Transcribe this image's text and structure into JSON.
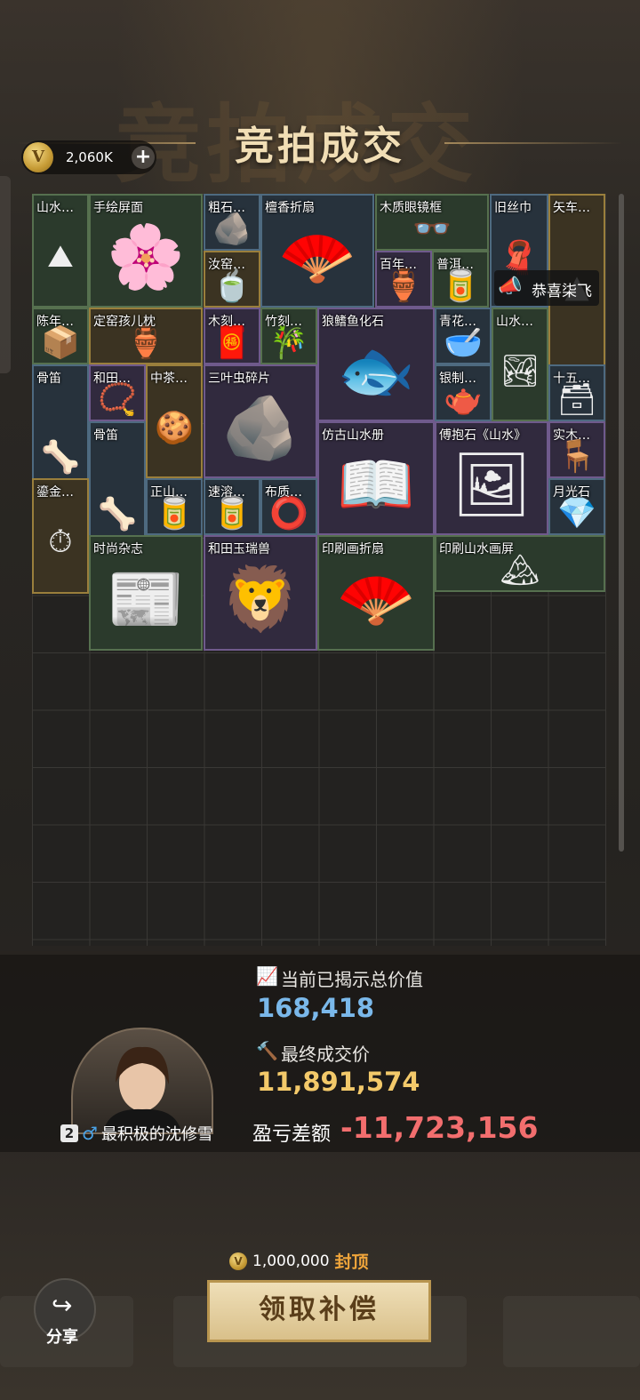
{
  "header": {
    "ghost_title": "竞拍成交",
    "title": "竞拍成交",
    "coins": "2,060K",
    "coin_symbol": "V",
    "add_symbol": "+"
  },
  "items": [
    {
      "label": "山水…",
      "art": "⛰",
      "color": "g"
    },
    {
      "label": "手绘屏面",
      "art": "🌸",
      "color": "g"
    },
    {
      "label": "粗石…",
      "art": "🪨",
      "color": "b"
    },
    {
      "label": "檀香折扇",
      "art": "🪭",
      "color": "b"
    },
    {
      "label": "木质眼镜框",
      "art": "👓",
      "color": "g"
    },
    {
      "label": "旧丝巾",
      "art": "🧣",
      "color": "b"
    },
    {
      "label": "矢车…",
      "art": "▲",
      "color": "y"
    },
    {
      "label": "汝窑…",
      "art": "🍵",
      "color": "y"
    },
    {
      "label": "百年…",
      "art": "🏺",
      "color": "p"
    },
    {
      "label": "普洱…",
      "art": "🥫",
      "color": "g"
    },
    {
      "label": "陈年…",
      "art": "📦",
      "color": "g"
    },
    {
      "label": "定窑孩儿枕",
      "art": "🏺",
      "color": "y"
    },
    {
      "label": "木刻…",
      "art": "🧧",
      "color": "p"
    },
    {
      "label": "竹刻…",
      "art": "🎋",
      "color": "g"
    },
    {
      "label": "狼鳍鱼化石",
      "art": "🐟",
      "color": "p"
    },
    {
      "label": "青花…",
      "art": "🥣",
      "color": "b"
    },
    {
      "label": "山水…",
      "art": "🏞",
      "color": "g"
    },
    {
      "label": "骨笛",
      "art": "🦴",
      "color": "b"
    },
    {
      "label": "和田…",
      "art": "📿",
      "color": "p"
    },
    {
      "label": "中茶…",
      "art": "🍪",
      "color": "y"
    },
    {
      "label": "三叶虫碎片",
      "art": "🪨",
      "color": "p"
    },
    {
      "label": "银制…",
      "art": "🫖",
      "color": "b"
    },
    {
      "label": "十五…",
      "art": "🗃",
      "color": "b"
    },
    {
      "label": "骨笛",
      "art": "🦴",
      "color": "b"
    },
    {
      "label": "仿古山水册",
      "art": "📖",
      "color": "p"
    },
    {
      "label": "傅抱石《山水》",
      "art": "🖼",
      "color": "p"
    },
    {
      "label": "实木…",
      "art": "🪑",
      "color": "p"
    },
    {
      "label": "鎏金…",
      "art": "⏱",
      "color": "y"
    },
    {
      "label": "正山…",
      "art": "🥫",
      "color": "b"
    },
    {
      "label": "速溶…",
      "art": "🥫",
      "color": "b"
    },
    {
      "label": "布质…",
      "art": "⭕",
      "color": "b"
    },
    {
      "label": "月光石",
      "art": "💎",
      "color": "b"
    },
    {
      "label": "时尚杂志",
      "art": "📰",
      "color": "g"
    },
    {
      "label": "和田玉瑞兽",
      "art": "🦁",
      "color": "p"
    },
    {
      "label": "印刷画折扇",
      "art": "🪭",
      "color": "g"
    },
    {
      "label": "印刷山水画屏",
      "art": "🏔",
      "color": "g"
    }
  ],
  "toast": {
    "text": "恭喜柒飞",
    "icon": "megaphone-icon"
  },
  "stats": {
    "revealed_label": "当前已揭示总价值",
    "revealed_value": "168,418",
    "final_label": "最终成交价",
    "final_value": "11,891,574",
    "pl_label": "盈亏差额",
    "pl_value": "-11,723,156"
  },
  "player": {
    "rank": "2",
    "sex": "♂",
    "name": "最积极的沈修雪"
  },
  "cap": {
    "amount": "1,000,000",
    "label": "封顶"
  },
  "actions": {
    "claim": "领取补偿",
    "share": "分享"
  },
  "colors": {
    "accent_gold": "#f3c96a",
    "value_blue": "#7ab8ea",
    "loss_red": "#f26e6e"
  }
}
